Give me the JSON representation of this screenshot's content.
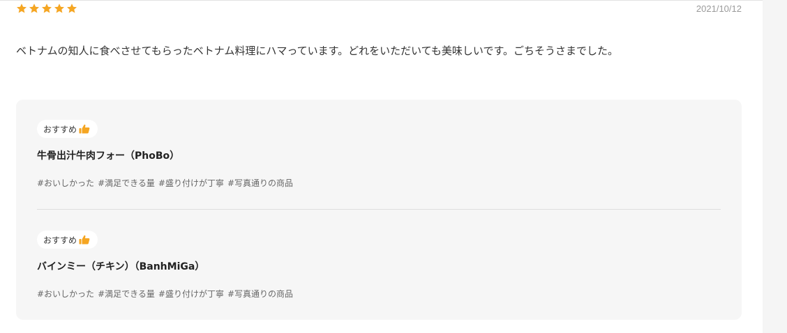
{
  "review": {
    "rating": 5,
    "max_rating": 5,
    "date": "2021/10/12",
    "comment": "ベトナムの知人に食べさせてもらったベトナム料理にハマっています。どれをいただいても美味しいです。ごちそうさまでした。",
    "star_color": "#f5a623"
  },
  "items": [
    {
      "badge": "おすすめ",
      "badge_icon": "thumbs-up-icon",
      "name": "牛骨出汁牛肉フォー（PhoBo）",
      "tags": [
        "#おいしかった",
        "#満足できる量",
        "#盛り付けが丁寧",
        "#写真通りの商品"
      ]
    },
    {
      "badge": "おすすめ",
      "badge_icon": "thumbs-up-icon",
      "name": "バインミー（チキン）（BanhMiGa）",
      "tags": [
        "#おいしかった",
        "#満足できる量",
        "#盛り付けが丁寧",
        "#写真通りの商品"
      ]
    }
  ]
}
